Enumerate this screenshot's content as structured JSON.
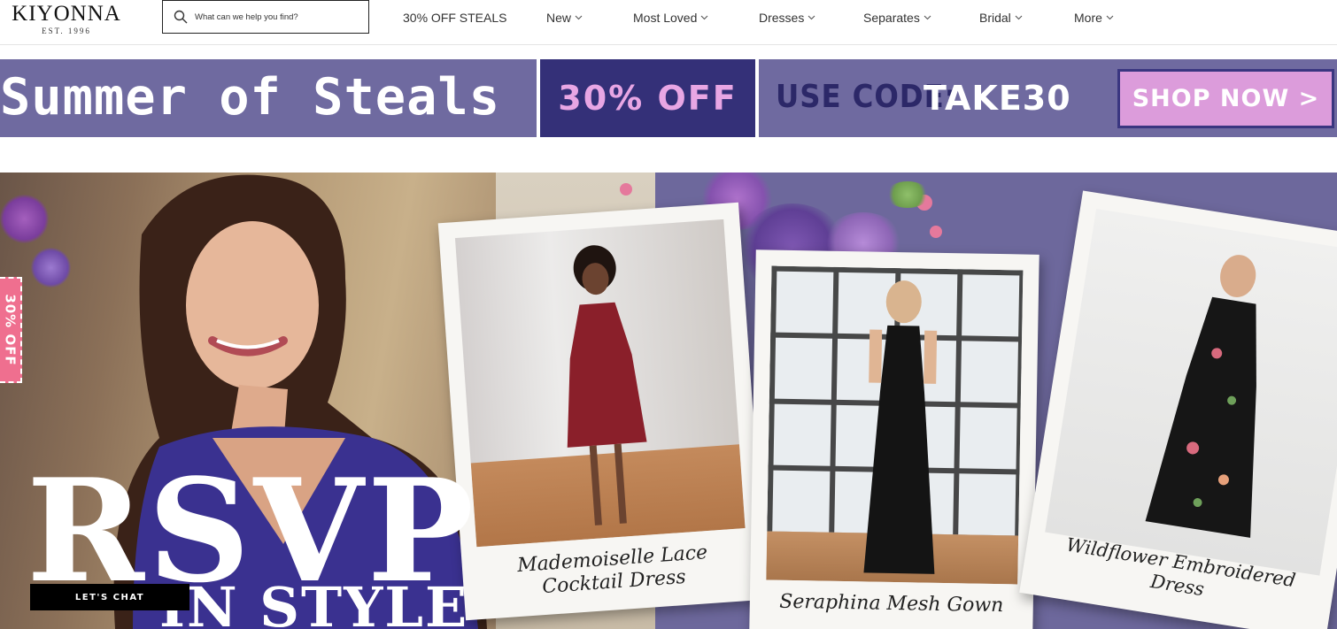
{
  "header": {
    "logo_text": "KIYONNA",
    "logo_tagline": "EST. 1996",
    "search_placeholder": "What can we help you find?",
    "nav": [
      {
        "label": "30% OFF STEALS",
        "has_dropdown": false
      },
      {
        "label": "New",
        "has_dropdown": true
      },
      {
        "label": "Most Loved",
        "has_dropdown": true
      },
      {
        "label": "Dresses",
        "has_dropdown": true
      },
      {
        "label": "Separates",
        "has_dropdown": true
      },
      {
        "label": "Bridal",
        "has_dropdown": true
      },
      {
        "label": "More",
        "has_dropdown": true
      }
    ]
  },
  "promo": {
    "title": "Summer of Steals",
    "discount": "30% OFF",
    "code_label": "USE CODE:",
    "code": "TAKE30",
    "cta": "SHOP NOW >"
  },
  "hero": {
    "side_tab": "30% OFF",
    "headline": "RSVP",
    "subheadline": "IN STYLE",
    "products": [
      {
        "caption_line1": "Mademoiselle Lace",
        "caption_line2": "Cocktail Dress"
      },
      {
        "caption_line1": "Seraphina Mesh Gown",
        "caption_line2": ""
      },
      {
        "caption_line1": "Wildflower Embroidered",
        "caption_line2": "Dress"
      }
    ]
  },
  "chat": {
    "label": "LET'S CHAT"
  },
  "colors": {
    "promo_purple": "#6f6aa0",
    "promo_navy": "#343078",
    "promo_pink": "#dc9cdb",
    "side_tab_pink": "#ef6f8f",
    "hero_lavender": "#6d689c"
  }
}
